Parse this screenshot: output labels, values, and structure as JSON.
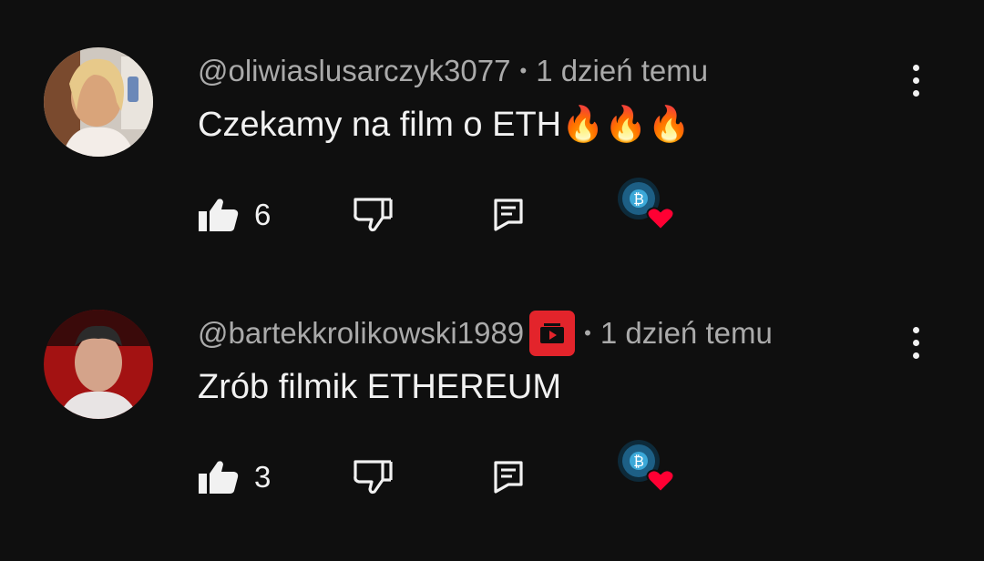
{
  "comments": [
    {
      "handle": "@oliwiaslusarczyk3077",
      "separator": "•",
      "time": "1 dzień temu",
      "text": "Czekamy na film o ETH",
      "emoji": "🔥🔥🔥",
      "likes": "6",
      "verified": false
    },
    {
      "handle": "@bartekkrolikowski1989",
      "separator": "•",
      "time": "1 dzień temu",
      "text": "Zrób filmik ETHEREUM",
      "emoji": "",
      "likes": "3",
      "verified": true
    }
  ],
  "icons": {
    "like": "thumbs-up-icon",
    "dislike": "thumbs-down-icon",
    "reply": "reply-icon",
    "more": "more-vert-icon",
    "creator_heart": "creator-heart-icon",
    "creator_badge": "youtube-member-badge-icon"
  },
  "colors": {
    "background": "#0f0f0f",
    "meta_text": "#aaaaaa",
    "text": "#f1f1f1",
    "heart": "#ff0033",
    "badge": "#e3242b"
  }
}
